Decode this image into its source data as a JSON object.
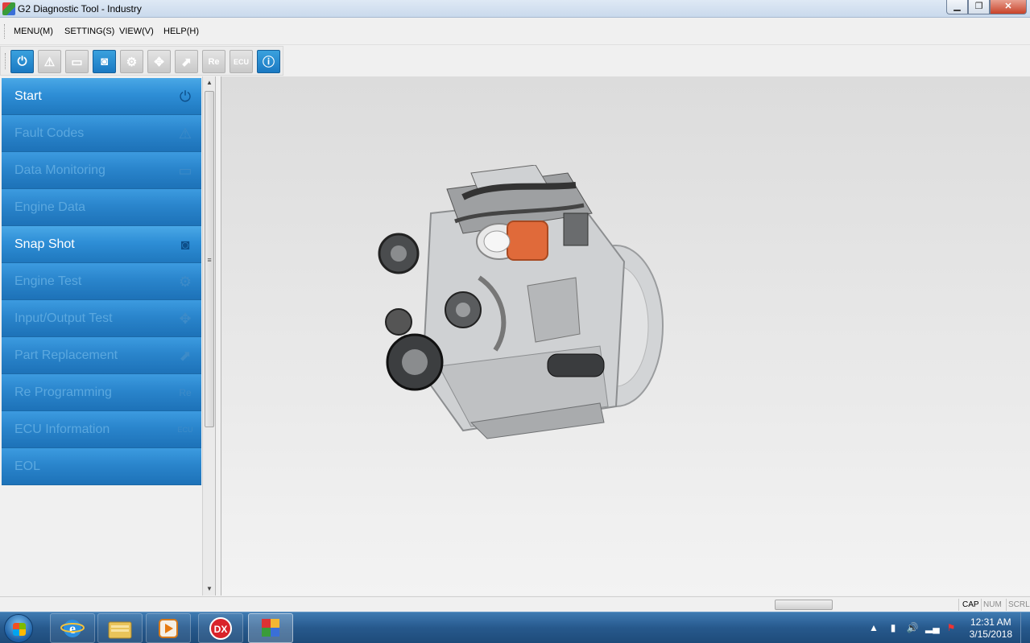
{
  "window": {
    "title": "G2 Diagnostic Tool - Industry",
    "min": "▁",
    "max": "❐",
    "close": "✕"
  },
  "menu": [
    {
      "label": "MENU(M)"
    },
    {
      "label": "SETTING(S)"
    },
    {
      "label": "VIEW(V)"
    },
    {
      "label": "HELP(H)"
    }
  ],
  "toolbar": [
    {
      "icon": "power-icon",
      "glyph": "⏻",
      "state": "active"
    },
    {
      "icon": "warning-icon",
      "glyph": "⚠",
      "state": "inactive"
    },
    {
      "icon": "monitor-icon",
      "glyph": "▭",
      "state": "inactive"
    },
    {
      "icon": "camera-icon",
      "glyph": "◙",
      "state": "active"
    },
    {
      "icon": "gears-icon",
      "glyph": "⚙",
      "state": "inactive"
    },
    {
      "icon": "arrows-icon",
      "glyph": "✥",
      "state": "inactive"
    },
    {
      "icon": "replace-icon",
      "glyph": "⬈",
      "state": "inactive"
    },
    {
      "icon": "reprogram-icon",
      "glyph": "Re",
      "state": "inactive"
    },
    {
      "icon": "ecu-icon",
      "glyph": "ECU",
      "state": "inactive"
    },
    {
      "icon": "info-icon",
      "glyph": "ⓘ",
      "state": "active"
    }
  ],
  "nav": [
    {
      "label": "Start",
      "icon": "power-icon",
      "glyph": "⏻",
      "enabled": true
    },
    {
      "label": "Fault Codes",
      "icon": "warning-icon",
      "glyph": "⚠",
      "enabled": false
    },
    {
      "label": "Data Monitoring",
      "icon": "monitor-icon",
      "glyph": "▭",
      "enabled": false
    },
    {
      "label": "Engine Data",
      "icon": "",
      "glyph": "",
      "enabled": false
    },
    {
      "label": "Snap Shot",
      "icon": "camera-icon",
      "glyph": "◙",
      "enabled": true
    },
    {
      "label": "Engine Test",
      "icon": "gears-icon",
      "glyph": "⚙",
      "enabled": false
    },
    {
      "label": "Input/Output Test",
      "icon": "arrows-icon",
      "glyph": "✥",
      "enabled": false
    },
    {
      "label": "Part Replacement",
      "icon": "replace-icon",
      "glyph": "⬈",
      "enabled": false
    },
    {
      "label": "Re Programming",
      "icon": "reprogram-icon",
      "glyph": "Re",
      "enabled": false
    },
    {
      "label": "ECU Information",
      "icon": "ecu-icon",
      "glyph": "ECU",
      "enabled": false
    },
    {
      "label": "EOL",
      "icon": "",
      "glyph": "",
      "enabled": false
    }
  ],
  "status": {
    "cap": "CAP",
    "num": "NUM",
    "scrl": "SCRL"
  },
  "taskbar": {
    "apps": [
      {
        "name": "internet-explorer-icon",
        "glyph": "e"
      },
      {
        "name": "file-explorer-icon",
        "glyph": "▤"
      },
      {
        "name": "media-player-icon",
        "glyph": "▶"
      },
      {
        "name": "dx-app-icon",
        "glyph": "DX"
      },
      {
        "name": "diagnostic-tool-app-icon",
        "glyph": "M"
      }
    ],
    "time": "12:31 AM",
    "date": "3/15/2018"
  }
}
